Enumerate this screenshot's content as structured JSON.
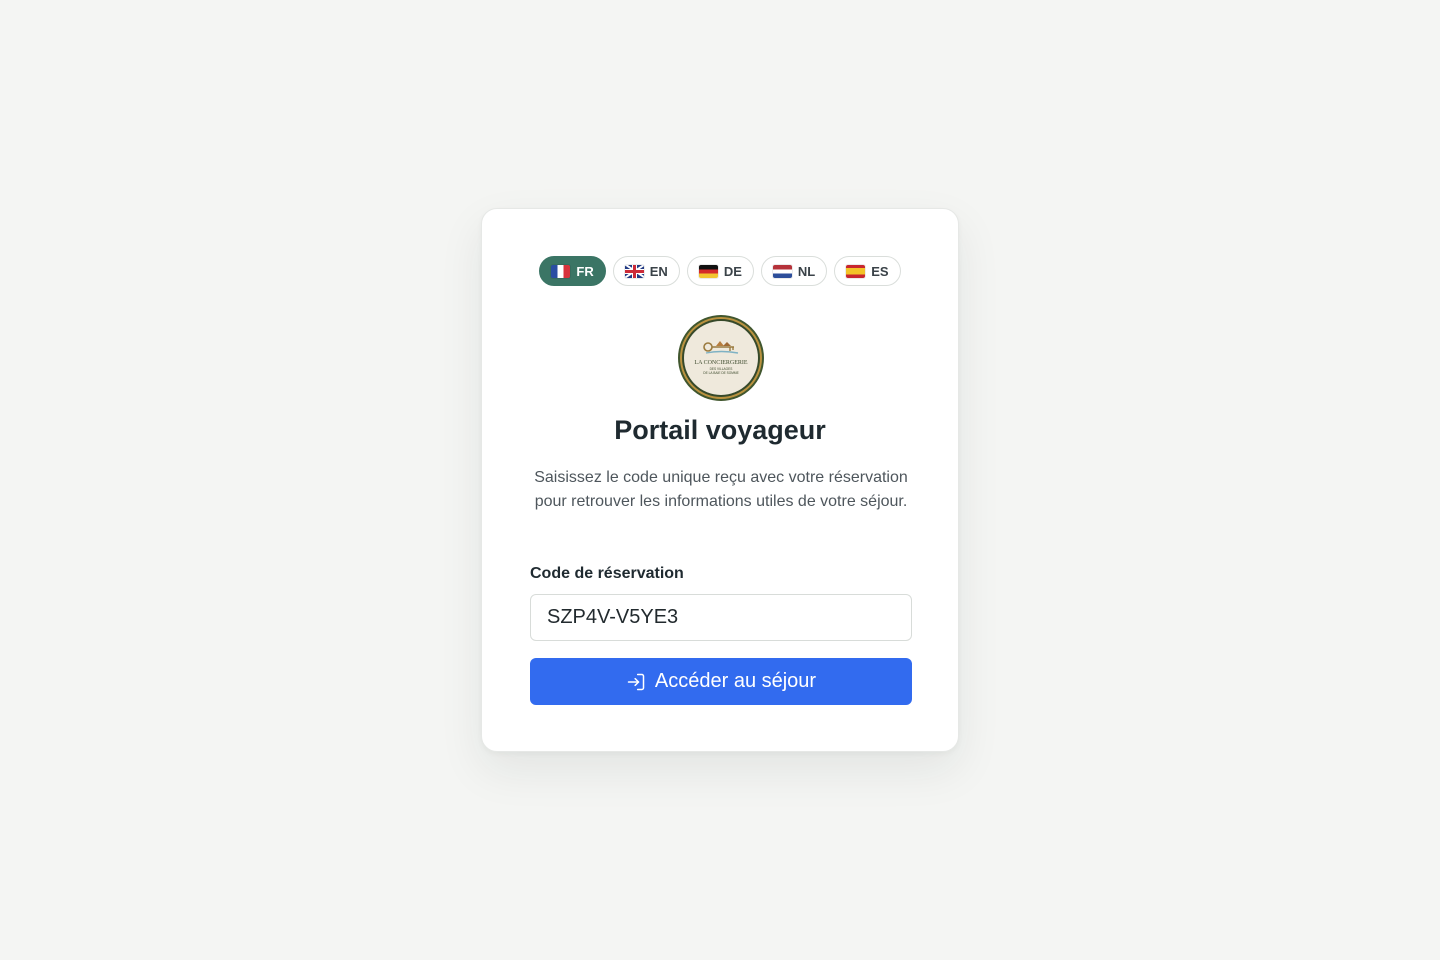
{
  "languages": [
    {
      "code": "FR",
      "flag": "france-flag-icon",
      "active": true
    },
    {
      "code": "EN",
      "flag": "uk-flag-icon",
      "active": false
    },
    {
      "code": "DE",
      "flag": "germany-flag-icon",
      "active": false
    },
    {
      "code": "NL",
      "flag": "netherlands-flag-icon",
      "active": false
    },
    {
      "code": "ES",
      "flag": "spain-flag-icon",
      "active": false
    }
  ],
  "logo": {
    "text_line1": "LA CONCIERGERIE",
    "text_line2": "DES VILLAGES",
    "text_line3": "DE LA BAIE DE SOMME"
  },
  "title": "Portail voyageur",
  "description": "Saisissez le code unique reçu avec votre réservation pour retrouver les informations utiles de votre séjour.",
  "form": {
    "label": "Code de réservation",
    "value": "SZP4V-V5YE3",
    "submit_label": "Accéder au séjour",
    "submit_icon": "login-icon"
  },
  "colors": {
    "background": "#f4f5f3",
    "active_language": "#3b7565",
    "primary_button": "#326bef"
  }
}
